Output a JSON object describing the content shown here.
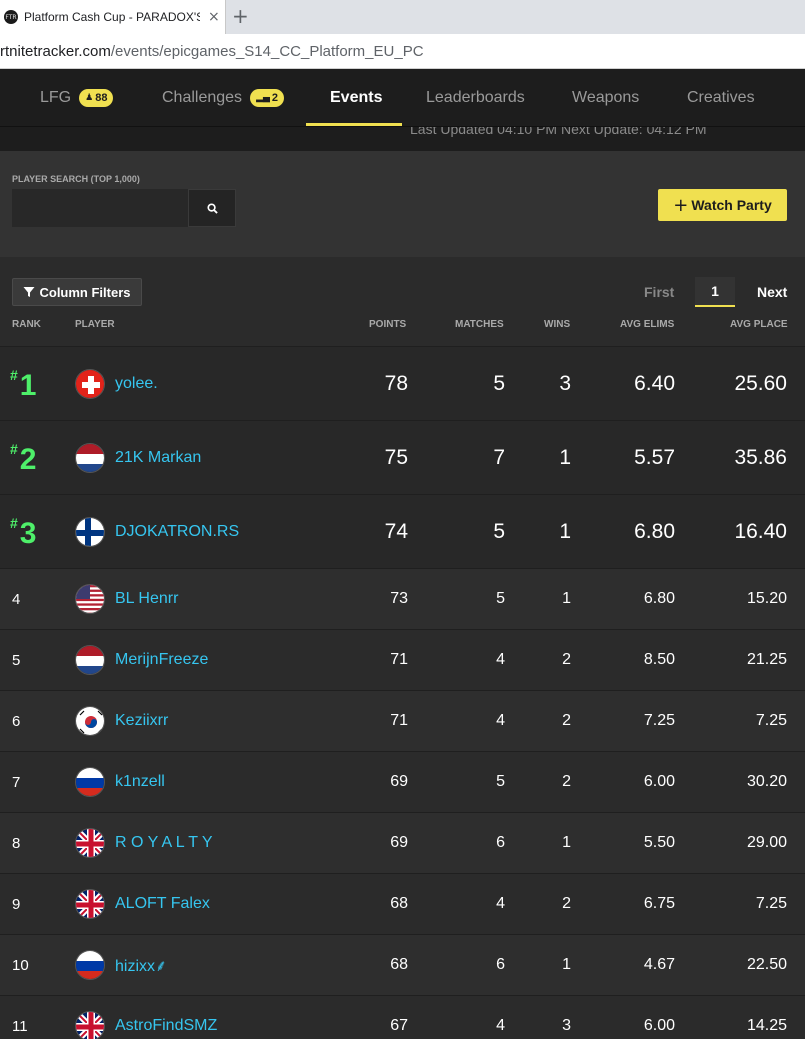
{
  "browser": {
    "tab_title": "Platform Cash Cup - PARADOX'S",
    "tab_close": "×",
    "new_tab": "+",
    "favicon": "FTR",
    "url_host": "rtnitetracker.com",
    "url_path": "/events/epicgames_S14_CC_Platform_EU_PC"
  },
  "nav": {
    "items": [
      {
        "label": "LFG",
        "badge": "88",
        "badge_icon": "person-icon"
      },
      {
        "label": "Challenges",
        "badge": "2",
        "badge_icon": "bars-icon"
      },
      {
        "label": "Events"
      },
      {
        "label": "Leaderboards"
      },
      {
        "label": "Weapons"
      },
      {
        "label": "Creatives"
      }
    ],
    "active": "Events",
    "last_updated": "Last Updated 04:10 PM Next Update: 04:12 PM"
  },
  "search": {
    "label": "PLAYER SEARCH (TOP 1,000)",
    "value": "",
    "placeholder": "",
    "button_icon": "search-icon"
  },
  "watch_party": {
    "label": "Watch Party",
    "icon": "+"
  },
  "filters": {
    "label": "Column Filters",
    "icon": "filter-icon"
  },
  "pager": {
    "first": "First",
    "current": "1",
    "next": "Next"
  },
  "columns": {
    "rank": "RANK",
    "player": "PLAYER",
    "points": "POINTS",
    "matches": "MATCHES",
    "wins": "WINS",
    "avg_elims": "AVG ELIMS",
    "avg_place": "AVG PLACE"
  },
  "colors": {
    "accent": "#f0e050",
    "rank_top": "#4ef06a",
    "player_link": "#36c6f0",
    "background": "#2b2b2b"
  },
  "rows": [
    {
      "rank": "1",
      "rank_prefix": "#",
      "flag": "switzerland",
      "player": "yolee.",
      "points": "78",
      "matches": "5",
      "wins": "3",
      "avg_elims": "6.40",
      "avg_place": "25.60"
    },
    {
      "rank": "2",
      "rank_prefix": "#",
      "flag": "netherlands",
      "player": "21K Markan",
      "points": "75",
      "matches": "7",
      "wins": "1",
      "avg_elims": "5.57",
      "avg_place": "35.86"
    },
    {
      "rank": "3",
      "rank_prefix": "#",
      "flag": "finland",
      "player": "DJOKATRON.RS",
      "points": "74",
      "matches": "5",
      "wins": "1",
      "avg_elims": "6.80",
      "avg_place": "16.40"
    },
    {
      "rank": "4",
      "flag": "usa",
      "player": "BL Henrr",
      "points": "73",
      "matches": "5",
      "wins": "1",
      "avg_elims": "6.80",
      "avg_place": "15.20"
    },
    {
      "rank": "5",
      "flag": "netherlands",
      "player": "MerijnFreeze",
      "points": "71",
      "matches": "4",
      "wins": "2",
      "avg_elims": "8.50",
      "avg_place": "21.25"
    },
    {
      "rank": "6",
      "flag": "south-korea",
      "player": "Keziixrr",
      "points": "71",
      "matches": "4",
      "wins": "2",
      "avg_elims": "7.25",
      "avg_place": "7.25"
    },
    {
      "rank": "7",
      "flag": "russia",
      "player": "k1nzell",
      "points": "69",
      "matches": "5",
      "wins": "2",
      "avg_elims": "6.00",
      "avg_place": "30.20"
    },
    {
      "rank": "8",
      "flag": "uk",
      "player": "R O Y A L T Y",
      "points": "69",
      "matches": "6",
      "wins": "1",
      "avg_elims": "5.50",
      "avg_place": "29.00"
    },
    {
      "rank": "9",
      "flag": "uk",
      "player": "ALOFT Falex",
      "points": "68",
      "matches": "4",
      "wins": "2",
      "avg_elims": "6.75",
      "avg_place": "7.25"
    },
    {
      "rank": "10",
      "flag": "russia",
      "player": "hizixx⸙",
      "points": "68",
      "matches": "6",
      "wins": "1",
      "avg_elims": "4.67",
      "avg_place": "22.50"
    },
    {
      "rank": "11",
      "flag": "uk",
      "player": "AstroFindSMZ",
      "points": "67",
      "matches": "4",
      "wins": "3",
      "avg_elims": "6.00",
      "avg_place": "14.25"
    }
  ]
}
